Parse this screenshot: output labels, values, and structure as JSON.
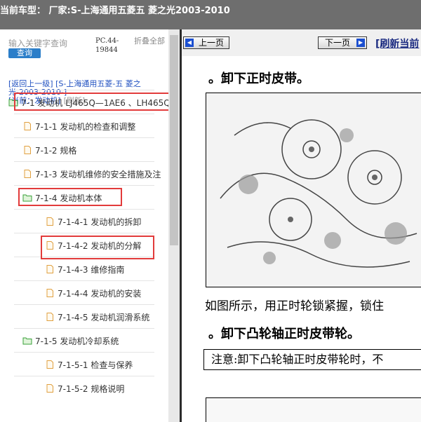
{
  "title": "当前车型：  厂家:S-上海通用五菱五  菱之光2003-2010",
  "search": {
    "placeholder": "输入关键字查询",
    "button": "查询"
  },
  "code": "PC.44-19844",
  "fold_all": "折叠全部",
  "nav": {
    "back": "[返回上一级]",
    "parent": "[S-上海通用五菱-五 菱之光-2003-2010-]",
    "current": "[当前：发动机]",
    "refresh": "[刷新]"
  },
  "tree": [
    {
      "label": "7-1 发动机 LJ465Q—1AE6 、LH465Q",
      "kind": "folder-open"
    },
    {
      "label": "7-1-1 发动机的检查和调整",
      "kind": "doc"
    },
    {
      "label": "7-1-2 规格",
      "kind": "doc"
    },
    {
      "label": "7-1-3 发动机维修的安全措施及注",
      "kind": "doc"
    },
    {
      "label": "7-1-4 发动机本体",
      "kind": "folder-open"
    },
    {
      "label": "7-1-4-1 发动机的拆卸",
      "kind": "doc"
    },
    {
      "label": "7-1-4-2 发动机的分解",
      "kind": "doc"
    },
    {
      "label": "7-1-4-3 维修指南",
      "kind": "doc"
    },
    {
      "label": "7-1-4-4 发动机的安装",
      "kind": "doc"
    },
    {
      "label": "7-1-4-5 发动机润滑系统",
      "kind": "doc"
    },
    {
      "label": "7-1-5 发动机冷却系统",
      "kind": "folder-open"
    },
    {
      "label": "7-1-5-1 检查与保养",
      "kind": "doc"
    },
    {
      "label": "7-1-5-2 规格说明",
      "kind": "doc"
    }
  ],
  "doc": {
    "prev": "上一页",
    "next": "下一页",
    "refresh": "[刷新当前",
    "heading1": "。卸下正时皮带。",
    "paragraph": "如图所示，用正时轮锁紧握，锁住",
    "heading2": "。卸下凸轮轴正时皮带轮。",
    "note": "注意:卸下凸轮轴正时皮带轮时，不"
  },
  "colors": {
    "titlebar": "#6e6e6e",
    "highlight": "#e23b3b",
    "link": "#2050c0",
    "folder": "#3aa23a",
    "doc": "#e0a040"
  }
}
